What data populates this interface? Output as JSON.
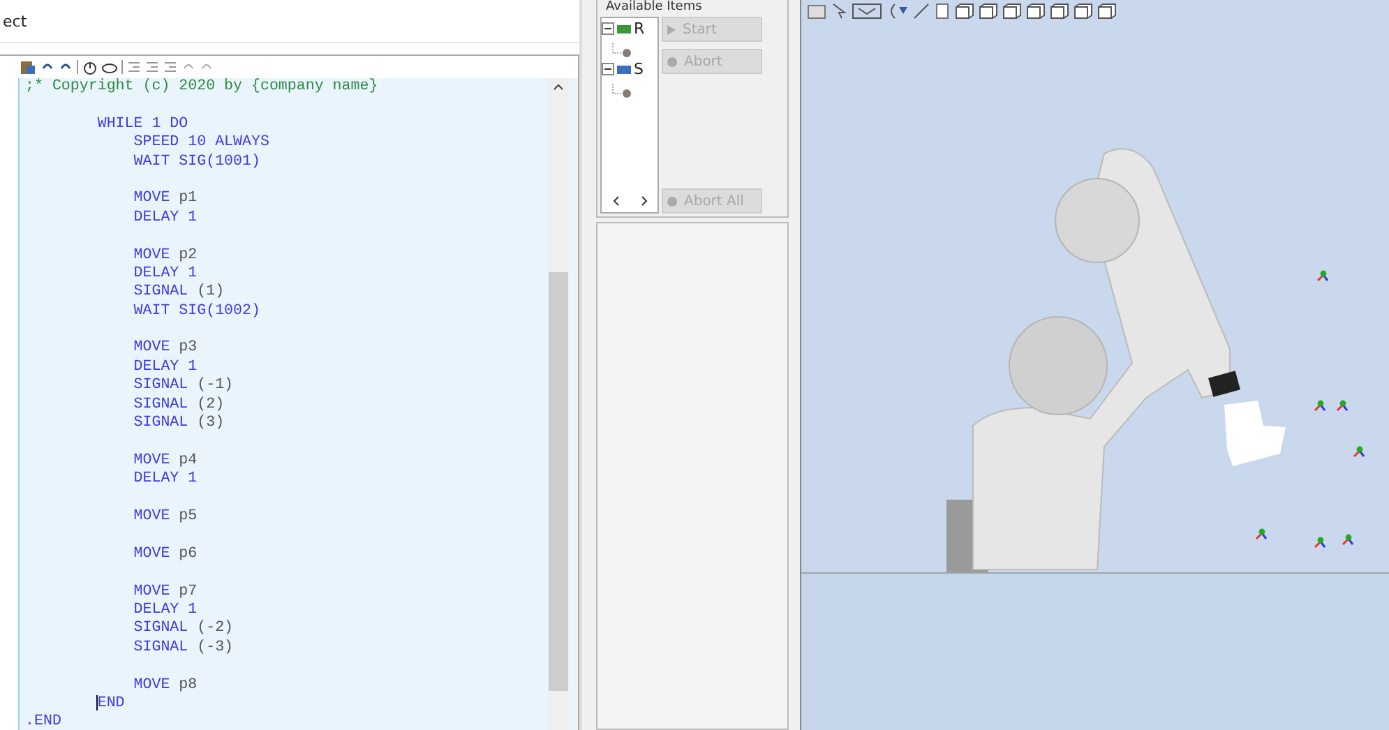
{
  "editor": {
    "title": "ect",
    "lines": [
      {
        "kind": "comment",
        "text": ";* Copyright (c) 2020 by {company name}"
      },
      {
        "kind": "blank"
      },
      {
        "kind": "code",
        "keyword": "        WHILE 1 DO"
      },
      {
        "kind": "code",
        "keyword": "            SPEED 10 ALWAYS"
      },
      {
        "kind": "code",
        "keyword": "            WAIT SIG(1001)"
      },
      {
        "kind": "blank"
      },
      {
        "kind": "code",
        "keyword": "            MOVE",
        "arg": " p1"
      },
      {
        "kind": "code",
        "keyword": "            DELAY 1"
      },
      {
        "kind": "blank"
      },
      {
        "kind": "code",
        "keyword": "            MOVE",
        "arg": " p2"
      },
      {
        "kind": "code",
        "keyword": "            DELAY 1"
      },
      {
        "kind": "code",
        "keyword": "            SIGNAL",
        "arg": " (1)"
      },
      {
        "kind": "code",
        "keyword": "            WAIT SIG(1002)"
      },
      {
        "kind": "blank"
      },
      {
        "kind": "code",
        "keyword": "            MOVE",
        "arg": " p3"
      },
      {
        "kind": "code",
        "keyword": "            DELAY 1"
      },
      {
        "kind": "code",
        "keyword": "            SIGNAL",
        "arg": " (-1)"
      },
      {
        "kind": "code",
        "keyword": "            SIGNAL",
        "arg": " (2)"
      },
      {
        "kind": "code",
        "keyword": "            SIGNAL",
        "arg": " (3)"
      },
      {
        "kind": "blank"
      },
      {
        "kind": "code",
        "keyword": "            MOVE",
        "arg": " p4"
      },
      {
        "kind": "code",
        "keyword": "            DELAY 1"
      },
      {
        "kind": "blank"
      },
      {
        "kind": "code",
        "keyword": "            MOVE",
        "arg": " p5"
      },
      {
        "kind": "blank"
      },
      {
        "kind": "code",
        "keyword": "            MOVE",
        "arg": " p6"
      },
      {
        "kind": "blank"
      },
      {
        "kind": "code",
        "keyword": "            MOVE",
        "arg": " p7"
      },
      {
        "kind": "code",
        "keyword": "            DELAY 1"
      },
      {
        "kind": "code",
        "keyword": "            SIGNAL",
        "arg": " (-2)"
      },
      {
        "kind": "code",
        "keyword": "            SIGNAL",
        "arg": " (-3)"
      },
      {
        "kind": "blank"
      },
      {
        "kind": "code",
        "keyword": "            MOVE",
        "arg": " p8"
      },
      {
        "kind": "code",
        "keyword": "        END",
        "cursor": true
      },
      {
        "kind": "code",
        "keyword": ".END"
      }
    ]
  },
  "monitor": {
    "group_label": "Available Items",
    "tree": [
      {
        "label": "R",
        "kind": "robot",
        "expanded": true,
        "children": [
          {
            "kind": "task"
          }
        ]
      },
      {
        "label": "S",
        "kind": "server",
        "expanded": true,
        "children": [
          {
            "kind": "task"
          }
        ]
      }
    ],
    "buttons": [
      {
        "label": "Start",
        "kind": "start",
        "disabled": true
      },
      {
        "label": "Abort",
        "kind": "abort",
        "disabled": true
      },
      {
        "label": "Abort All",
        "kind": "abort",
        "disabled": true
      }
    ]
  }
}
